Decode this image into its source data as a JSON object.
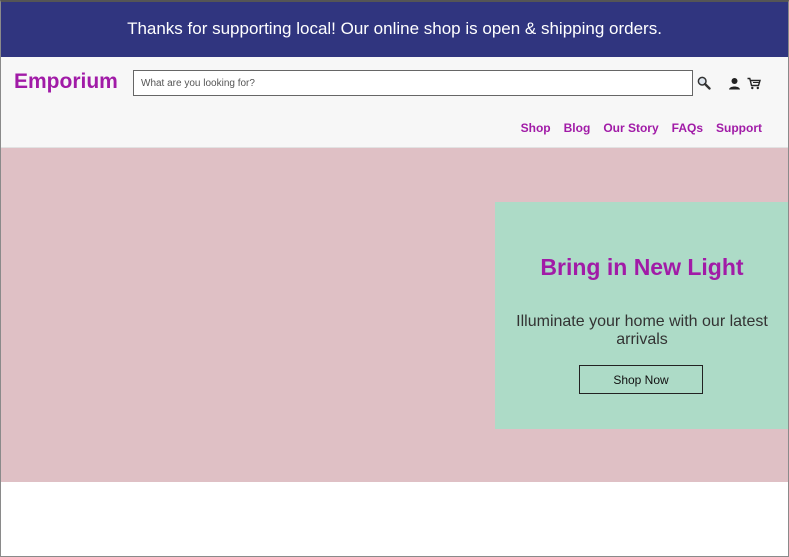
{
  "promo": {
    "message": "Thanks for supporting local! Our online shop is open & shipping orders."
  },
  "header": {
    "logo": "Emporium",
    "search": {
      "placeholder": "What are you looking for?",
      "value": ""
    },
    "icons": {
      "search": "search-icon",
      "account": "user-icon",
      "cart": "cart-icon"
    },
    "nav": [
      "Shop",
      "Blog",
      "Our Story",
      "FAQs",
      "Support"
    ]
  },
  "hero": {
    "title": "Bring in New Light",
    "text": "Illuminate your home with our latest arrivals",
    "button_label": "Shop Now"
  },
  "colors": {
    "promo_bg": "#30357f",
    "brand": "#a11ba7",
    "hero_bg": "#dfc0c5",
    "card_bg": "#addbc7"
  }
}
